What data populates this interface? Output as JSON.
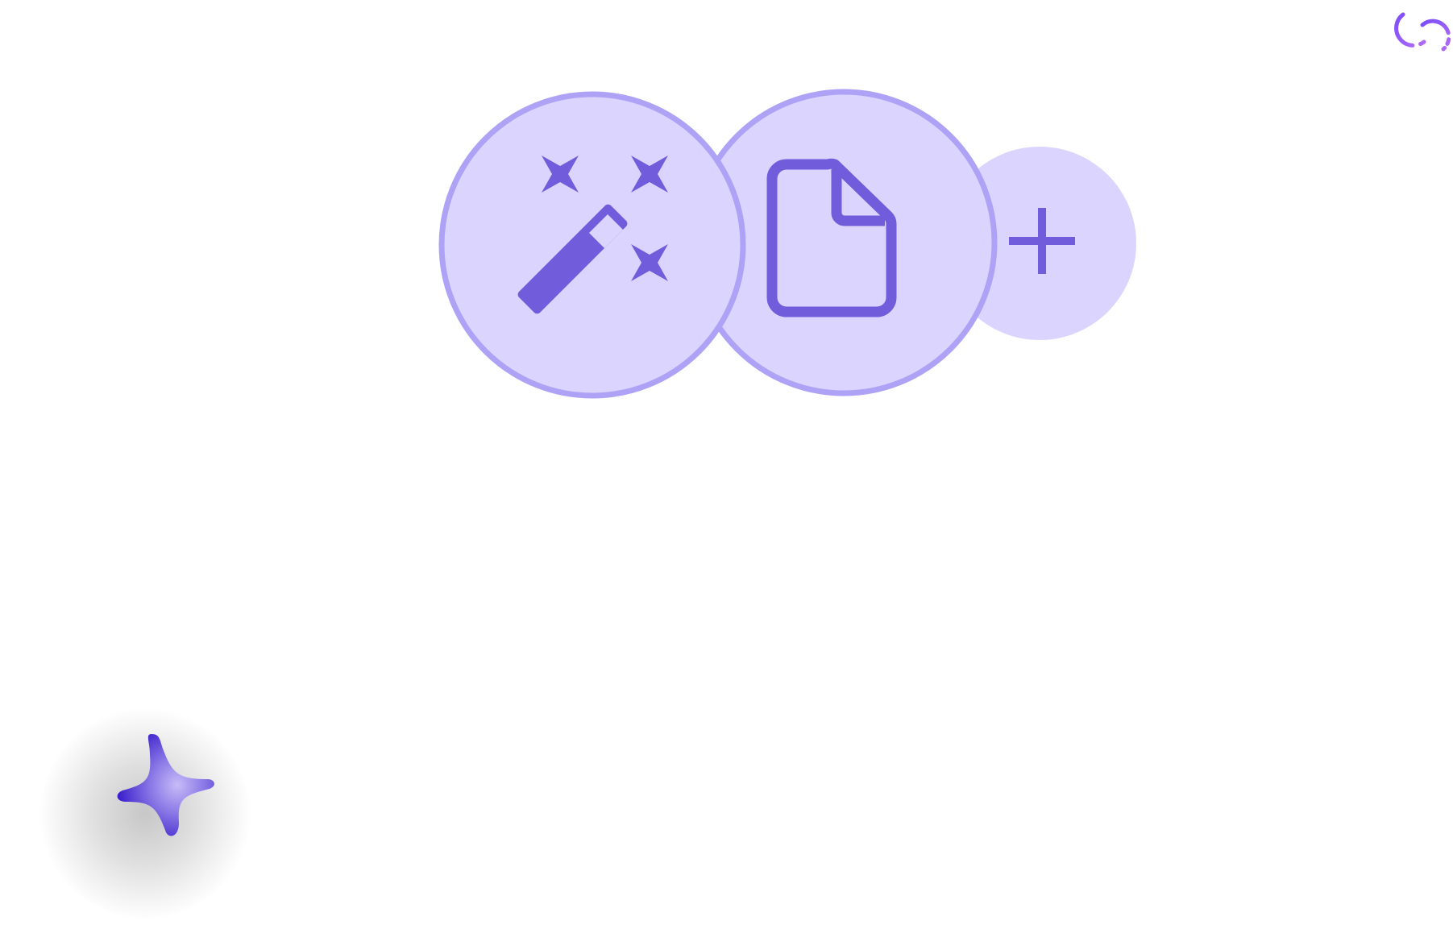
{
  "colors": {
    "circle_fill": "#dbd4fe",
    "circle_stroke": "#aea2f6",
    "icon": "#715ddb",
    "loader_gradient_start": "#8b5cf6",
    "loader_gradient_end": "#a855f7",
    "sparkle_dark": "#4a30d4",
    "sparkle_light": "#b3a6f3"
  },
  "icons": {
    "loader": "loading-spinner-icon",
    "magic": "magic-wand-sparkles-icon",
    "document": "document-icon",
    "add": "plus-icon",
    "assistant": "sparkle-icon"
  }
}
